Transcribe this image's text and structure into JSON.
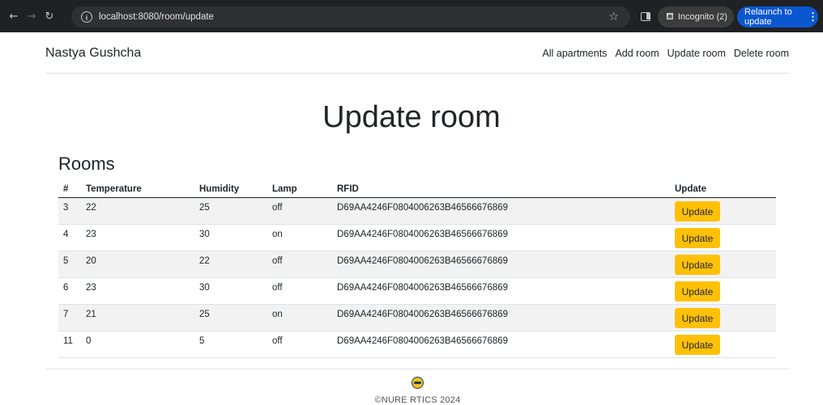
{
  "browser": {
    "url": "localhost:8080/room/update",
    "incognito_label": "Incognito (2)",
    "relaunch_label": "Relaunch to update",
    "icons": [
      "back-arrow-icon",
      "forward-arrow-icon",
      "reload-icon",
      "info-icon",
      "star-icon",
      "side-panel-icon",
      "incognito-icon",
      "more-vert-icon"
    ]
  },
  "navbar": {
    "brand": "Nastya Gushcha",
    "links": [
      "All apartments",
      "Add room",
      "Update room",
      "Delete room"
    ]
  },
  "page": {
    "title": "Update room",
    "section_title": "Rooms"
  },
  "table": {
    "headers": [
      "#",
      "Temperature",
      "Humidity",
      "Lamp",
      "RFID",
      "Update"
    ],
    "rows": [
      {
        "id": "3",
        "temperature": "22",
        "humidity": "25",
        "lamp": "off",
        "rfid": "D69AA4246F0804006263B46566676869",
        "action": "Update"
      },
      {
        "id": "4",
        "temperature": "23",
        "humidity": "30",
        "lamp": "on",
        "rfid": "D69AA4246F0804006263B46566676869",
        "action": "Update"
      },
      {
        "id": "5",
        "temperature": "20",
        "humidity": "22",
        "lamp": "off",
        "rfid": "D69AA4246F0804006263B46566676869",
        "action": "Update"
      },
      {
        "id": "6",
        "temperature": "23",
        "humidity": "30",
        "lamp": "off",
        "rfid": "D69AA4246F0804006263B46566676869",
        "action": "Update"
      },
      {
        "id": "7",
        "temperature": "21",
        "humidity": "25",
        "lamp": "on",
        "rfid": "D69AA4246F0804006263B46566676869",
        "action": "Update"
      },
      {
        "id": "11",
        "temperature": "0",
        "humidity": "5",
        "lamp": "off",
        "rfid": "D69AA4246F0804006263B46566676869",
        "action": "Update"
      }
    ]
  },
  "footer": {
    "text": "©NURE RTICS 2024"
  },
  "colors": {
    "update_button": "#ffc107",
    "relaunch_button": "#0b57d0",
    "chrome_bar": "#202124"
  }
}
